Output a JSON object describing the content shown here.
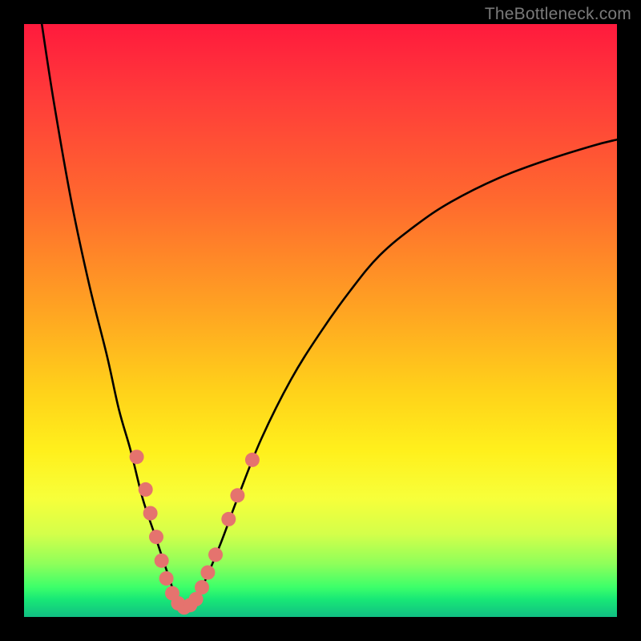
{
  "watermark": "TheBottleneck.com",
  "chart_data": {
    "type": "line",
    "title": "",
    "xlabel": "",
    "ylabel": "",
    "xlim": [
      0,
      100
    ],
    "ylim": [
      0,
      100
    ],
    "series": [
      {
        "name": "curve",
        "x": [
          3,
          5,
          8,
          11,
          14,
          16,
          18,
          20,
          22,
          24,
          25,
          26,
          27,
          28,
          30,
          33,
          36,
          40,
          45,
          50,
          55,
          60,
          66,
          72,
          80,
          88,
          96,
          100
        ],
        "values": [
          100,
          87,
          70,
          56,
          44,
          35,
          28,
          20,
          14,
          8,
          5,
          2.5,
          1.6,
          2.2,
          5,
          12,
          20,
          30,
          40,
          48,
          55,
          61,
          66,
          70,
          74,
          77,
          79.5,
          80.5
        ]
      }
    ],
    "markers": {
      "color": "#e5736e",
      "radius": 9,
      "points": [
        {
          "x": 19.0,
          "y": 27.0
        },
        {
          "x": 20.5,
          "y": 21.5
        },
        {
          "x": 21.3,
          "y": 17.5
        },
        {
          "x": 22.3,
          "y": 13.5
        },
        {
          "x": 23.2,
          "y": 9.5
        },
        {
          "x": 24.0,
          "y": 6.5
        },
        {
          "x": 25.0,
          "y": 4.0
        },
        {
          "x": 26.0,
          "y": 2.3
        },
        {
          "x": 27.0,
          "y": 1.6
        },
        {
          "x": 28.0,
          "y": 2.0
        },
        {
          "x": 29.0,
          "y": 3.0
        },
        {
          "x": 30.0,
          "y": 5.0
        },
        {
          "x": 31.0,
          "y": 7.5
        },
        {
          "x": 32.3,
          "y": 10.5
        },
        {
          "x": 34.5,
          "y": 16.5
        },
        {
          "x": 36.0,
          "y": 20.5
        },
        {
          "x": 38.5,
          "y": 26.5
        }
      ]
    },
    "background": {
      "type": "vertical-gradient",
      "stops": [
        {
          "pos": 0.0,
          "color": "#ff1a3d"
        },
        {
          "pos": 0.5,
          "color": "#ffd21a"
        },
        {
          "pos": 0.8,
          "color": "#f7ff3a"
        },
        {
          "pos": 1.0,
          "color": "#11bf83"
        }
      ]
    }
  }
}
